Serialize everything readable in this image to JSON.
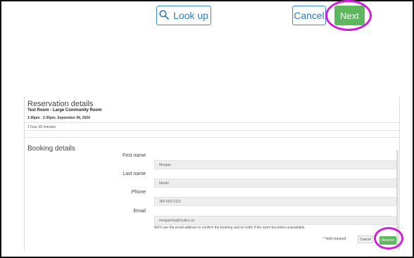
{
  "toolbar": {
    "lookup_label": "Look up",
    "cancel_label": "Cancel",
    "next_label": "Next"
  },
  "reservation": {
    "title": "Reservation details",
    "room": "Test Room - Large Community Room",
    "time": "1:00pm - 2:30pm, September 06, 2024",
    "duration": "1 hour 30 minutes"
  },
  "booking": {
    "title": "Booking details",
    "fields": [
      {
        "label": "First name",
        "value": "Morgan"
      },
      {
        "label": "Last name",
        "value": "Martin"
      },
      {
        "label": "Phone",
        "value": "360-600-2115"
      },
      {
        "label": "Email",
        "value": "morganma@multco.us"
      }
    ],
    "help_text": "We'll use the email address to confirm the booking and to notify if the room becomes unavailable.",
    "required_note": "field required",
    "required_star": "*",
    "cancel_label": "Cancel",
    "reserve_label": "Reserve"
  },
  "colors": {
    "accent_blue": "#2f7bbf",
    "success_green": "#5cb85c",
    "highlight_magenta": "#d21fd6"
  },
  "icons": {
    "lookup": "search-icon"
  }
}
